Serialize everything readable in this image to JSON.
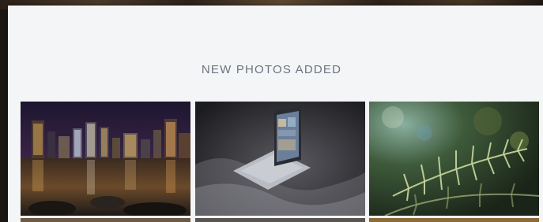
{
  "section": {
    "title": "NEW PHOTOS ADDED"
  },
  "photos": [
    {
      "subject": "city-skyline-night"
    },
    {
      "subject": "laptop-on-bed"
    },
    {
      "subject": "fern-leaves"
    }
  ]
}
